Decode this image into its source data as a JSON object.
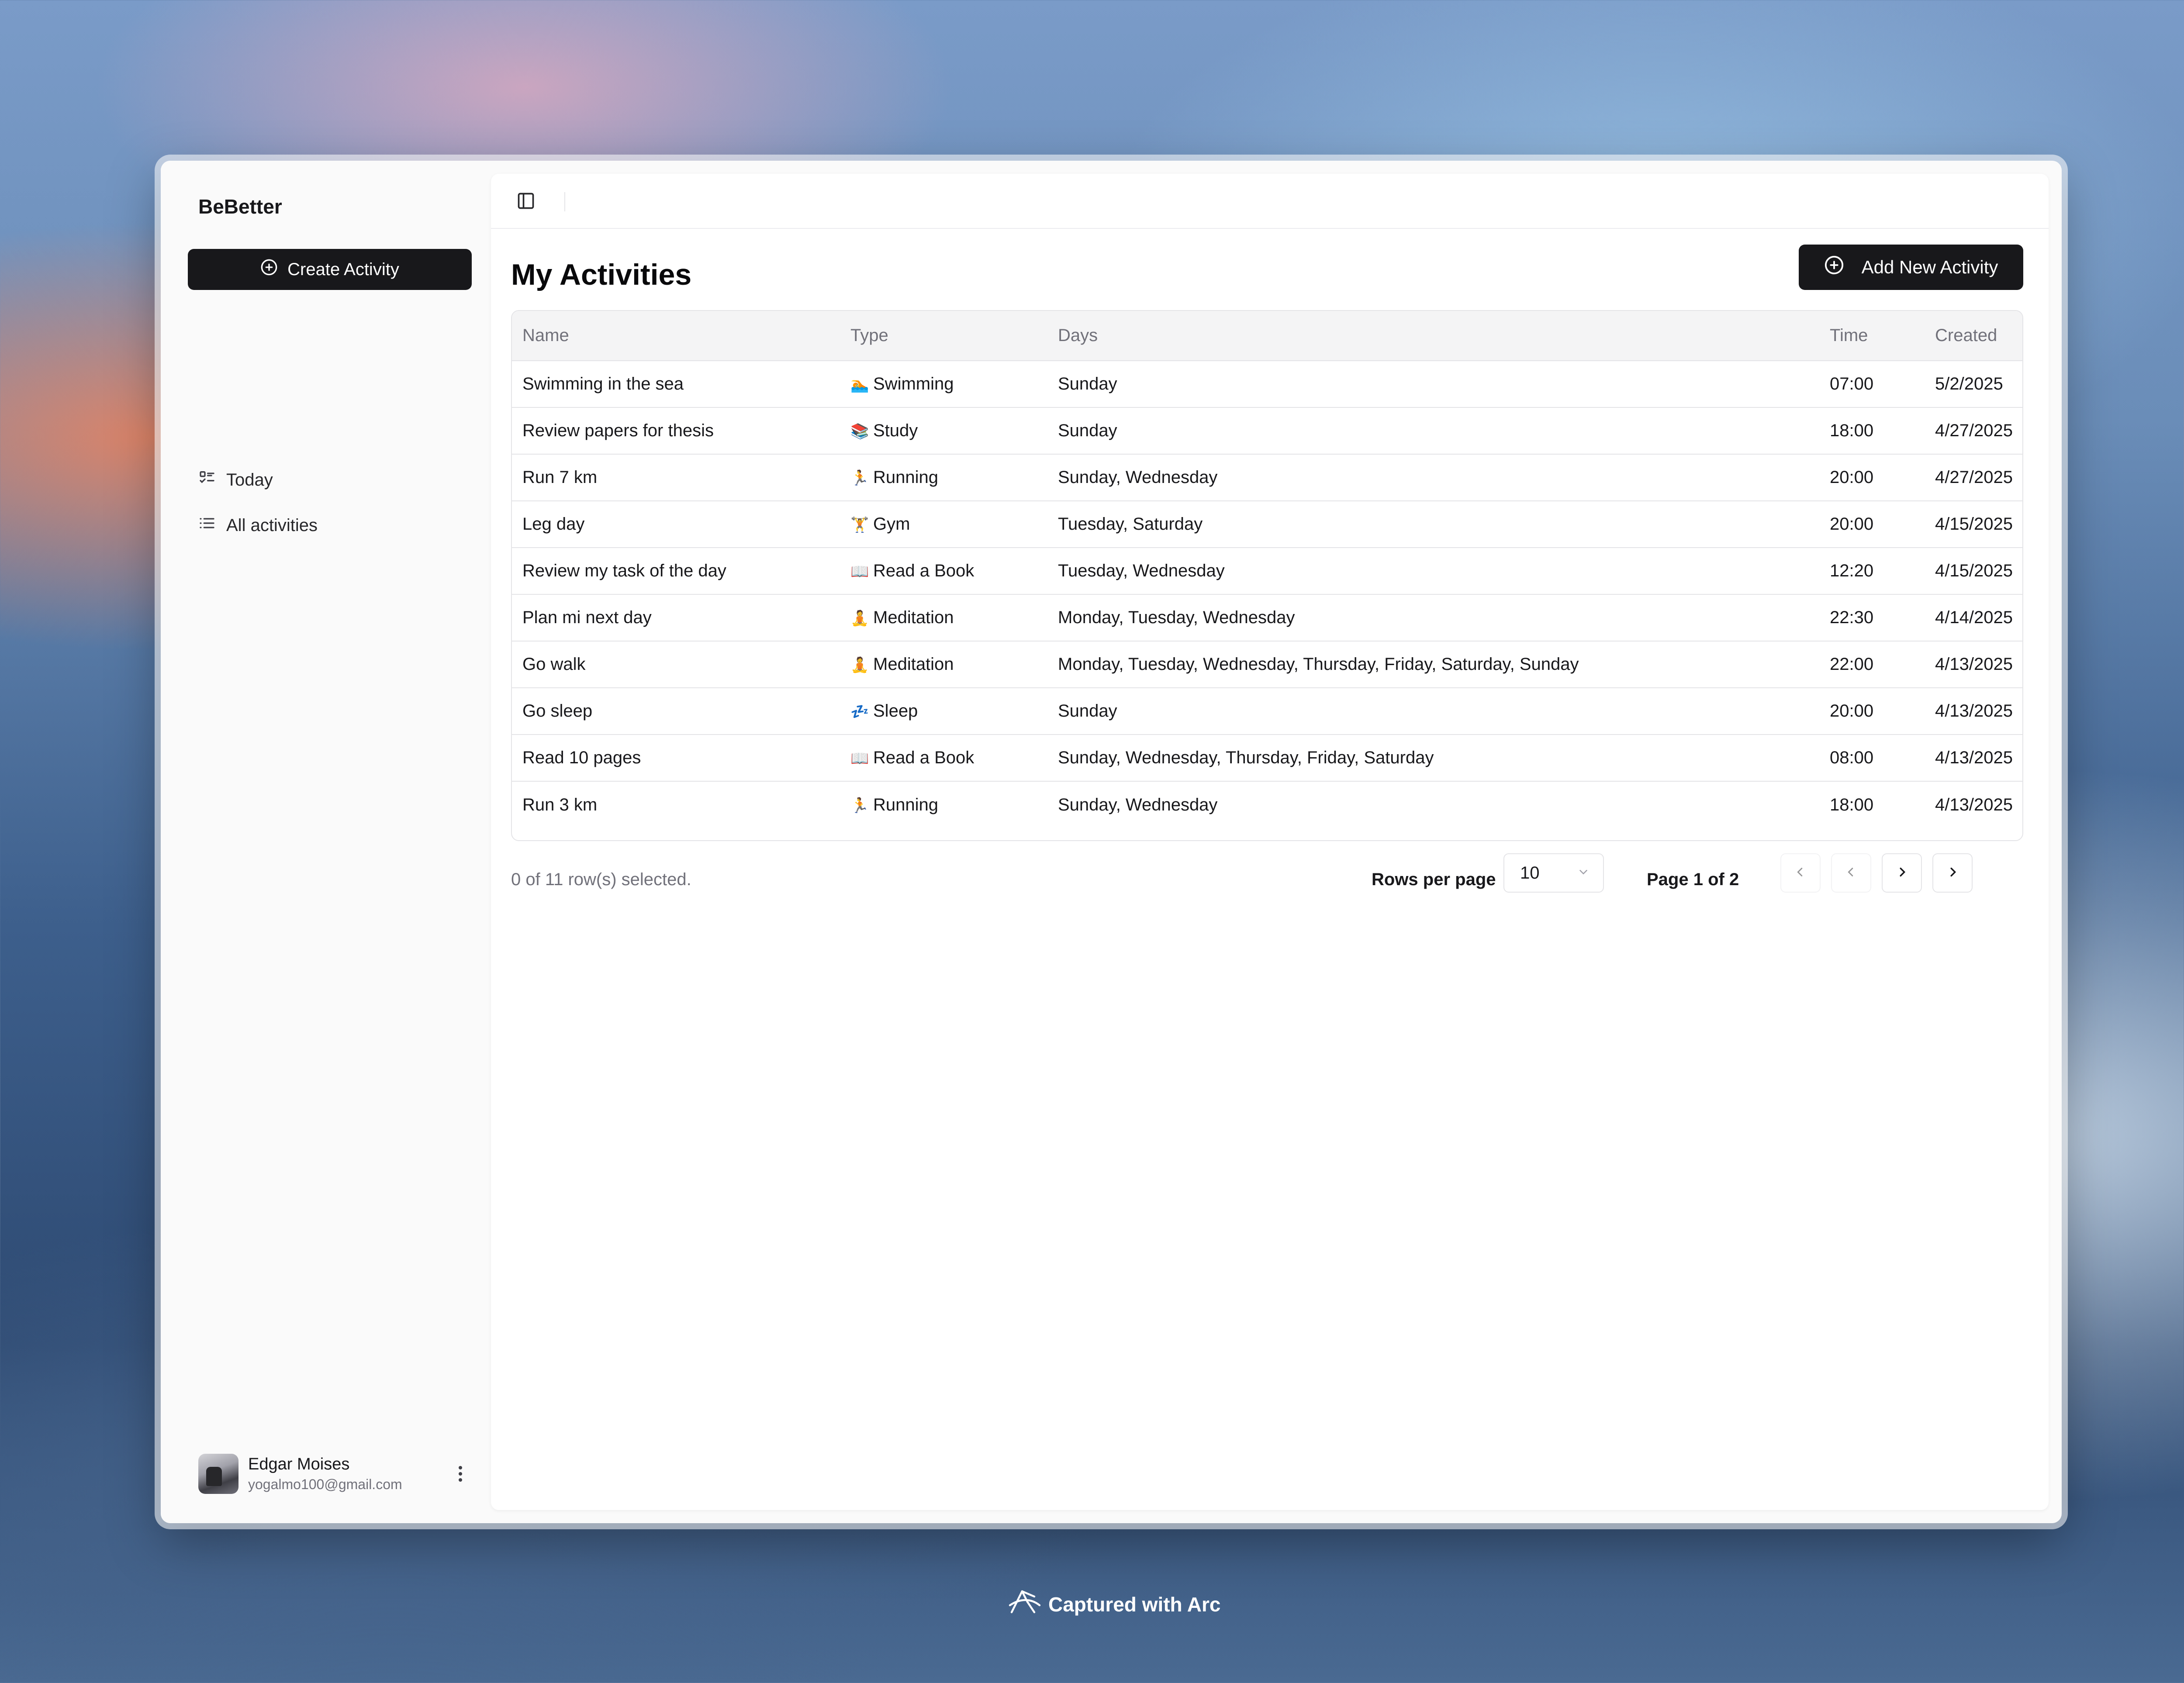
{
  "app": {
    "brand": "BeBetter"
  },
  "sidebar": {
    "create_label": "Create Activity",
    "nav": [
      {
        "label": "Today",
        "icon": "list-checks-icon"
      },
      {
        "label": "All activities",
        "icon": "list-icon"
      }
    ],
    "user": {
      "name": "Edgar Moises",
      "email": "yogalmo100@gmail.com"
    }
  },
  "main": {
    "title": "My Activities",
    "add_label": "Add New Activity",
    "table": {
      "headers": {
        "name": "Name",
        "type": "Type",
        "days": "Days",
        "time": "Time",
        "created": "Created"
      },
      "rows": [
        {
          "name": "Swimming in the sea",
          "type_icon": "🏊",
          "type": "Swimming",
          "days": "Sunday",
          "time": "07:00",
          "created": "5/2/2025"
        },
        {
          "name": "Review papers for thesis",
          "type_icon": "📚",
          "type": "Study",
          "days": "Sunday",
          "time": "18:00",
          "created": "4/27/2025"
        },
        {
          "name": "Run 7 km",
          "type_icon": "🏃",
          "type": "Running",
          "days": "Sunday, Wednesday",
          "time": "20:00",
          "created": "4/27/2025"
        },
        {
          "name": "Leg day",
          "type_icon": "🏋",
          "type": "Gym",
          "days": "Tuesday, Saturday",
          "time": "20:00",
          "created": "4/15/2025"
        },
        {
          "name": "Review my task of the day",
          "type_icon": "📖",
          "type": "Read a Book",
          "days": "Tuesday, Wednesday",
          "time": "12:20",
          "created": "4/15/2025"
        },
        {
          "name": "Plan mi next day",
          "type_icon": "🧘",
          "type": "Meditation",
          "days": "Monday, Tuesday, Wednesday",
          "time": "22:30",
          "created": "4/14/2025"
        },
        {
          "name": "Go walk",
          "type_icon": "🧘",
          "type": "Meditation",
          "days": "Monday, Tuesday, Wednesday, Thursday, Friday, Saturday, Sunday",
          "time": "22:00",
          "created": "4/13/2025"
        },
        {
          "name": "Go sleep",
          "type_icon": "💤",
          "type": "Sleep",
          "days": "Sunday",
          "time": "20:00",
          "created": "4/13/2025"
        },
        {
          "name": "Read 10 pages",
          "type_icon": "📖",
          "type": "Read a Book",
          "days": "Sunday, Wednesday, Thursday, Friday, Saturday",
          "time": "08:00",
          "created": "4/13/2025"
        },
        {
          "name": "Run 3 km",
          "type_icon": "🏃",
          "type": "Running",
          "days": "Sunday, Wednesday",
          "time": "18:00",
          "created": "4/13/2025"
        }
      ]
    },
    "footer": {
      "selection": "0 of 11 row(s) selected.",
      "rows_per_page_label": "Rows per page",
      "rows_per_page_value": "10",
      "page_label": "Page 1 of 2"
    }
  },
  "badge": {
    "label": "Captured with Arc"
  },
  "colors": {
    "primary": "#18181b",
    "muted": "#71717a",
    "border": "#e4e4e7"
  }
}
